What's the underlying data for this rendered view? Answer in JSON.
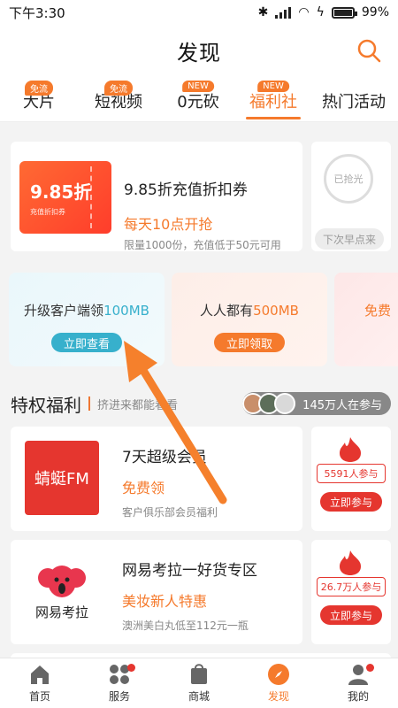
{
  "status_bar": {
    "time": "下午3:30",
    "battery": "99%"
  },
  "header": {
    "title": "发现"
  },
  "tabs": [
    {
      "label": "大片",
      "badge": "免流"
    },
    {
      "label": "短视频",
      "badge": "免流"
    },
    {
      "label": "0元砍",
      "badge": "NEW"
    },
    {
      "label": "福利社",
      "badge": "NEW",
      "active": true
    },
    {
      "label": "热门活动",
      "badge": ""
    }
  ],
  "coupon": {
    "image_text": "9.85折",
    "image_caption": "充值折扣券",
    "title": "9.85折充值折扣券",
    "subtitle": "每天10点开抢",
    "limit": "限量1000份，充值低于50元可用"
  },
  "sold_out": {
    "badge": "已抢光",
    "button": "下次早点来"
  },
  "upgrades": [
    {
      "text_prefix": "升级客户端领",
      "highlight": "100MB",
      "button": "立即查看"
    },
    {
      "text_prefix": "人人都有",
      "highlight": "500MB",
      "button": "立即领取"
    },
    {
      "text_prefix": "免费",
      "highlight": "",
      "button": ""
    }
  ],
  "privilege_section": {
    "title": "特权福利",
    "subtitle": "挤进来都能看看",
    "participants": "145万人在参与"
  },
  "privileges": [
    {
      "logo_text": "蜻蜓FM",
      "title": "7天超级会员",
      "subtitle": "免费领",
      "desc": "客户俱乐部会员福利",
      "count": "5591人参与",
      "button": "立即参与"
    },
    {
      "logo_text": "网易考拉",
      "title": "网易考拉一好货专区",
      "subtitle": "美妆新人特惠",
      "desc": "澳洲美白丸低至112元一瓶",
      "count": "26.7万人参与",
      "button": "立即参与"
    }
  ],
  "bottom_nav": [
    {
      "label": "首页",
      "icon": "home-icon"
    },
    {
      "label": "服务",
      "icon": "services-icon",
      "dot": true
    },
    {
      "label": "商城",
      "icon": "shop-icon"
    },
    {
      "label": "发现",
      "icon": "compass-icon",
      "active": true
    },
    {
      "label": "我的",
      "icon": "profile-icon",
      "dot": true
    }
  ],
  "colors": {
    "accent": "#f57a2c",
    "red": "#e5362f",
    "teal": "#37b0cc"
  }
}
